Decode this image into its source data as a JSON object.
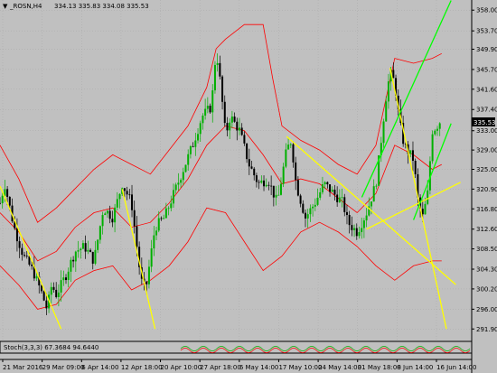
{
  "window": {
    "symbol": "_ROSN,H4",
    "ohlc_readout": "334.13 335.83 334.08 335.53",
    "corner_arrow": "▼"
  },
  "indicator": {
    "label": "Stoch(3,3,3) 67.3684 94.6440"
  },
  "colors": {
    "background": "#c0c0c0",
    "price_up": "#00b000",
    "price_down": "#000000",
    "bollinger": "#ff0000",
    "trendline_yellow": "#ffff00",
    "trendline_green": "#00ff00",
    "current_price_bg": "#000000",
    "current_price_fg": "#ffffff",
    "grid": "#a8a8a8"
  },
  "chart_data": {
    "type": "candlestick",
    "title": "_ROSN,H4",
    "grid": true,
    "current_price": "335.53",
    "y_ticks": [
      "358.00",
      "353.70",
      "349.90",
      "345.70",
      "341.60",
      "337.40",
      "333.00",
      "329.00",
      "325.00",
      "320.90",
      "316.80",
      "312.60",
      "308.50",
      "304.30",
      "300.20",
      "296.00",
      "291.90"
    ],
    "y_range": [
      289.7,
      360.1
    ],
    "x_ticks": [
      "21 Mar 2016",
      "29 Mar 09:00",
      "6 Apr 14:00",
      "12 Apr 18:00",
      "20 Apr 10:00",
      "27 Apr 18:00",
      "6 May 14:00",
      "17 May 10:00",
      "24 May 14:00",
      "31 May 18:00",
      "8 Jun 14:00",
      "16 Jun 14:00"
    ],
    "x_range": [
      0,
      100
    ],
    "price_path": [
      [
        0,
        318
      ],
      [
        1,
        322
      ],
      [
        3,
        313
      ],
      [
        5,
        307
      ],
      [
        7,
        304
      ],
      [
        9,
        299
      ],
      [
        10,
        296
      ],
      [
        11,
        301
      ],
      [
        12,
        299
      ],
      [
        14,
        303
      ],
      [
        16,
        308
      ],
      [
        18,
        309
      ],
      [
        20,
        306
      ],
      [
        22,
        317
      ],
      [
        24,
        315
      ],
      [
        26,
        322
      ],
      [
        28,
        318
      ],
      [
        30,
        302
      ],
      [
        31,
        300
      ],
      [
        33,
        313
      ],
      [
        35,
        315
      ],
      [
        37,
        320
      ],
      [
        39,
        325
      ],
      [
        41,
        330
      ],
      [
        43,
        336
      ],
      [
        45,
        338
      ],
      [
        46,
        350
      ],
      [
        47,
        342
      ],
      [
        48,
        332
      ],
      [
        49,
        336
      ],
      [
        51,
        333
      ],
      [
        53,
        326
      ],
      [
        55,
        322
      ],
      [
        57,
        323
      ],
      [
        59,
        318
      ],
      [
        61,
        329
      ],
      [
        62,
        331
      ],
      [
        63,
        322
      ],
      [
        65,
        315
      ],
      [
        67,
        318
      ],
      [
        69,
        322
      ],
      [
        71,
        320
      ],
      [
        73,
        318
      ],
      [
        74,
        314
      ],
      [
        76,
        312
      ],
      [
        78,
        316
      ],
      [
        80,
        322
      ],
      [
        81,
        330
      ],
      [
        82,
        339
      ],
      [
        83,
        345
      ],
      [
        84,
        343
      ],
      [
        85,
        335
      ],
      [
        86,
        330
      ],
      [
        88,
        327
      ],
      [
        89,
        318
      ],
      [
        90,
        315
      ],
      [
        91,
        320
      ],
      [
        92,
        333
      ],
      [
        93,
        334
      ],
      [
        94,
        335.5
      ]
    ],
    "series": [
      {
        "name": "",
        "color": "#ff0000",
        "points": [
          [
            0,
            330
          ],
          [
            4,
            323
          ],
          [
            8,
            314
          ],
          [
            12,
            317
          ],
          [
            16,
            321
          ],
          [
            20,
            325
          ],
          [
            24,
            328
          ],
          [
            28,
            326
          ],
          [
            32,
            324
          ],
          [
            36,
            329
          ],
          [
            40,
            334
          ],
          [
            44,
            342
          ],
          [
            46,
            350
          ],
          [
            48,
            352
          ],
          [
            52,
            355
          ],
          [
            56,
            355
          ],
          [
            58,
            344
          ],
          [
            60,
            334
          ],
          [
            64,
            331
          ],
          [
            68,
            329
          ],
          [
            72,
            326
          ],
          [
            76,
            324
          ],
          [
            80,
            330
          ],
          [
            84,
            348
          ],
          [
            88,
            347
          ],
          [
            92,
            348
          ],
          [
            94,
            349
          ]
        ]
      },
      {
        "name": "",
        "color": "#ff0000",
        "points": [
          [
            0,
            316
          ],
          [
            4,
            312
          ],
          [
            8,
            306
          ],
          [
            12,
            308
          ],
          [
            16,
            313
          ],
          [
            20,
            316
          ],
          [
            24,
            317
          ],
          [
            28,
            313
          ],
          [
            32,
            314
          ],
          [
            36,
            318
          ],
          [
            40,
            323
          ],
          [
            44,
            330
          ],
          [
            48,
            334
          ],
          [
            52,
            333
          ],
          [
            56,
            328
          ],
          [
            60,
            322
          ],
          [
            64,
            323
          ],
          [
            68,
            322
          ],
          [
            72,
            319
          ],
          [
            76,
            316
          ],
          [
            80,
            320
          ],
          [
            84,
            330
          ],
          [
            88,
            328
          ],
          [
            92,
            325
          ],
          [
            94,
            326
          ]
        ]
      },
      {
        "name": "",
        "color": "#ff0000",
        "points": [
          [
            0,
            305
          ],
          [
            4,
            301
          ],
          [
            8,
            296
          ],
          [
            12,
            297
          ],
          [
            16,
            302
          ],
          [
            20,
            304
          ],
          [
            24,
            305
          ],
          [
            28,
            300
          ],
          [
            32,
            302
          ],
          [
            36,
            305
          ],
          [
            40,
            310
          ],
          [
            44,
            317
          ],
          [
            48,
            316
          ],
          [
            52,
            310
          ],
          [
            56,
            304
          ],
          [
            60,
            307
          ],
          [
            64,
            312
          ],
          [
            68,
            314
          ],
          [
            72,
            312
          ],
          [
            76,
            309
          ],
          [
            80,
            305
          ],
          [
            84,
            302
          ],
          [
            88,
            305
          ],
          [
            92,
            306
          ],
          [
            94,
            306
          ]
        ]
      }
    ],
    "trend_lines": [
      {
        "color": "#ffff00",
        "from": [
          0,
          321.5
        ],
        "to": [
          13,
          291.9
        ]
      },
      {
        "color": "#ffff00",
        "from": [
          26,
          320.9
        ],
        "to": [
          33,
          291.9
        ]
      },
      {
        "color": "#ffff00",
        "from": [
          61,
          331.8
        ],
        "to": [
          97,
          301.1
        ]
      },
      {
        "color": "#ffff00",
        "from": [
          83,
          346.0
        ],
        "to": [
          95,
          291.9
        ]
      },
      {
        "color": "#ffff00",
        "from": [
          78,
          312.6
        ],
        "to": [
          98,
          322.3
        ]
      },
      {
        "color": "#00ff00",
        "from": [
          77,
          319.2
        ],
        "to": [
          96,
          360.0
        ]
      },
      {
        "color": "#00ff00",
        "from": [
          88,
          314.5
        ],
        "to": [
          96,
          334.5
        ]
      }
    ]
  }
}
